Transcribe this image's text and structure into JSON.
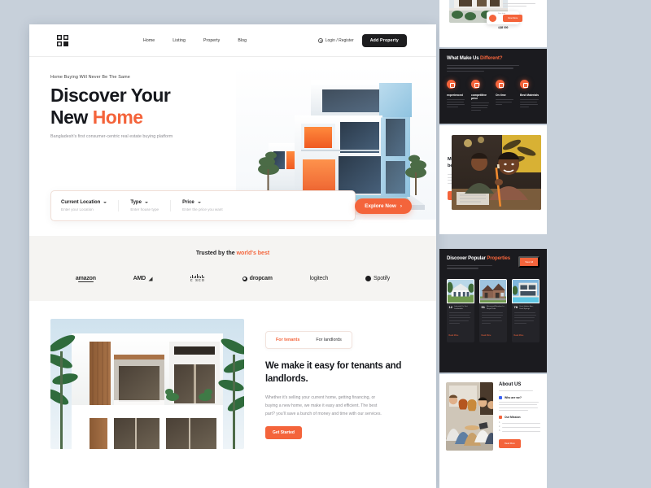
{
  "theme": {
    "accent": "#f4643b",
    "dark": "#1b1b1f",
    "page_bg": "#c7d0da",
    "text": "#16181d"
  },
  "nav": {
    "logo_name": "brand-logo",
    "links": [
      {
        "label": "Home"
      },
      {
        "label": "Listing"
      },
      {
        "label": "Property"
      },
      {
        "label": "Blog"
      }
    ],
    "login_label": "Login / Register",
    "cta_label": "Add Property"
  },
  "hero": {
    "eyebrow": "Home Buying Will Never Be The Same",
    "title_line1": "Discover Your",
    "title_line2_plain": "New ",
    "title_line2_accent": "Home",
    "subtitle": "Bangladesh's first consumer-centric real estate buying platform",
    "image_name": "modern-house-3d-render"
  },
  "search": {
    "fields": [
      {
        "label": "Current Location",
        "placeholder": "Enter your Location"
      },
      {
        "label": "Type",
        "placeholder": "Enter house type"
      },
      {
        "label": "Price",
        "placeholder": "Enter the price you want"
      }
    ],
    "cta_label": "Explore Now"
  },
  "trusted": {
    "heading_plain": "Trusted by the ",
    "heading_accent": "world's best",
    "brands": [
      {
        "name": "amazon"
      },
      {
        "name": "AMD"
      },
      {
        "name": "c sco"
      },
      {
        "name": "dropcam"
      },
      {
        "name": "logitech"
      },
      {
        "name": "Spotify"
      }
    ]
  },
  "tenants": {
    "image_name": "modern-villa-photo",
    "tabs": [
      {
        "label": "For tenants",
        "active": true
      },
      {
        "label": "For landlords",
        "active": false
      }
    ],
    "heading": "We make it easy for tenants and landlords.",
    "body": "Whether it's selling your current home, getting financing, or buying a new home, we make it easy and efficient. The best part? you'll save a bunch of money and time with our services.",
    "cta_label": "Get Started"
  },
  "right_top_card": {
    "image_name": "house-listing-photo",
    "price_label": "Start from",
    "price_value": "4,88 000",
    "cta_label": "View More"
  },
  "different": {
    "heading_plain": "What Make Us ",
    "heading_accent": "Different?",
    "features": [
      {
        "title": "experienced",
        "icon": "badge-icon"
      },
      {
        "title": "competitive price",
        "icon": "tag-icon"
      },
      {
        "title": "On time",
        "icon": "clock-icon"
      },
      {
        "title": "Best Materials",
        "icon": "shield-icon"
      }
    ]
  },
  "meet": {
    "heading": "Meet and talk with our best architecture",
    "cta_label": "Read More",
    "image_name": "architects-meeting-photo"
  },
  "popular": {
    "heading_plain": "Discover Popular ",
    "heading_accent": "Properties",
    "view_all_label": "View All",
    "cards": [
      {
        "number": "12",
        "subtitle": "Lakeside Dr, Fort Lauderdale",
        "meta": "Florida",
        "read_more": "Read More",
        "image_name": "colonial-house-photo"
      },
      {
        "number": "51",
        "subtitle": "Briarwood Meadow Ln, Royal Palm",
        "meta": "Florida",
        "read_more": "Read More",
        "image_name": "brick-house-photo"
      },
      {
        "number": "78",
        "subtitle": "Crest Harbor Ave, Coral Springs",
        "meta": "Florida",
        "read_more": "Read More",
        "image_name": "modern-pool-villa-photo"
      }
    ]
  },
  "about": {
    "heading": "About US",
    "who_title": "Who are we?",
    "mission_title": "Our Mission",
    "list_markers": [
      "1.",
      "2.",
      "3."
    ],
    "cta_label": "Read More",
    "image_name": "team-group-photo"
  }
}
